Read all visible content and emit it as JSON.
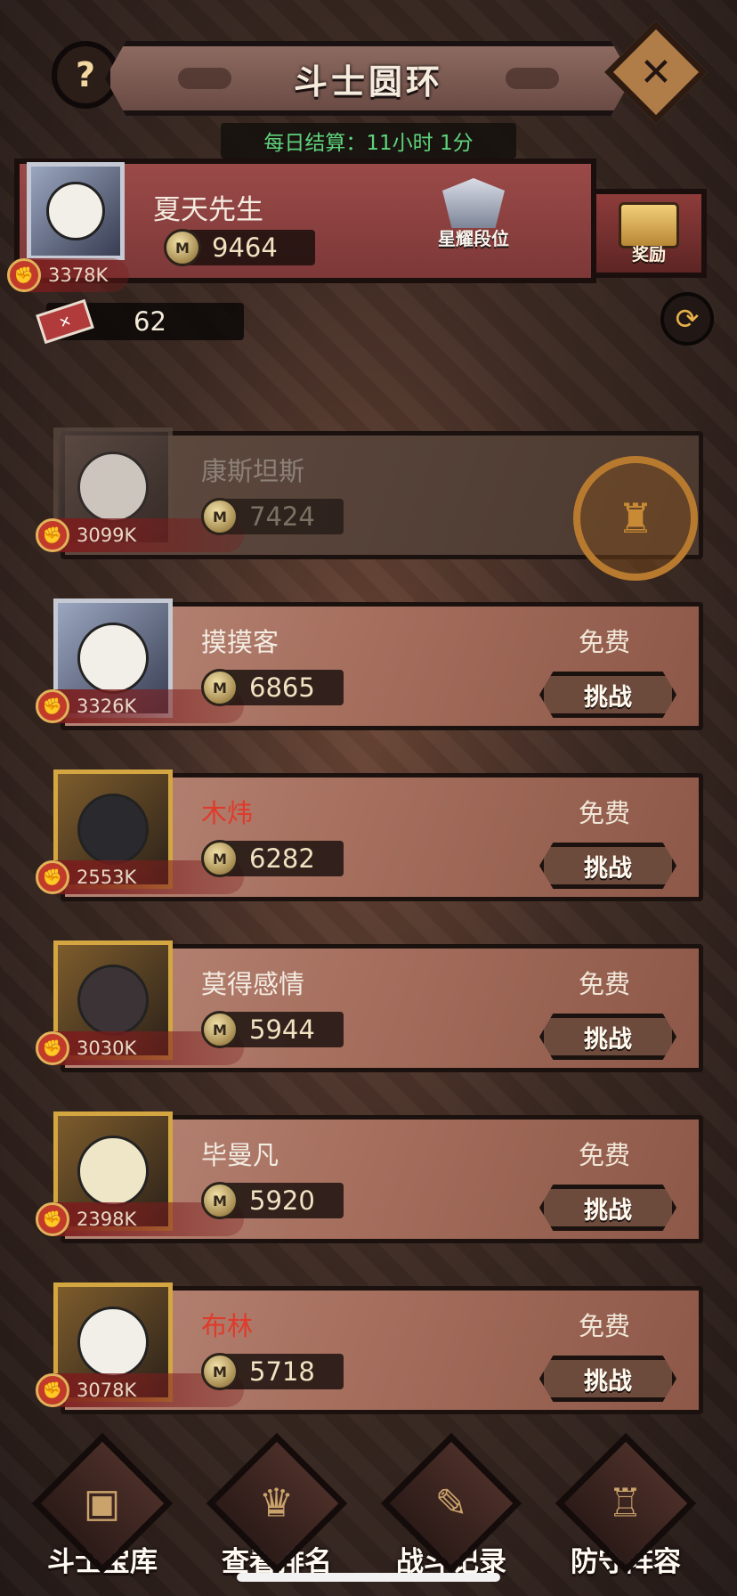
{
  "header": {
    "title": "斗士圆环",
    "help_icon": "?",
    "close_icon": "✕",
    "daily_settlement": "每日结算：11小时 1分"
  },
  "player": {
    "name": "夏天先生",
    "score": "9464",
    "power": "3378K",
    "rank_label": "星耀段位",
    "reward_label": "奖励",
    "tickets": "62"
  },
  "opponents": [
    {
      "name": "康斯坦斯",
      "score": "7424",
      "power": "3099K",
      "defeated": true
    },
    {
      "name": "摸摸客",
      "score": "6865",
      "power": "3326K",
      "free": "免费",
      "action": "挑战"
    },
    {
      "name": "木炜",
      "score": "6282",
      "power": "2553K",
      "free": "免费",
      "action": "挑战"
    },
    {
      "name": "莫得感情",
      "score": "5944",
      "power": "3030K",
      "free": "免费",
      "action": "挑战"
    },
    {
      "name": "毕曼凡",
      "score": "5920",
      "power": "2398K",
      "free": "免费",
      "action": "挑战"
    },
    {
      "name": "布林",
      "score": "5718",
      "power": "3078K",
      "free": "免费",
      "action": "挑战"
    }
  ],
  "bottom_nav": [
    {
      "label": "斗士宝库",
      "icon": "treasure-chest-icon"
    },
    {
      "label": "查看排名",
      "icon": "trophy-icon"
    },
    {
      "label": "战斗记录",
      "icon": "scroll-icon"
    },
    {
      "label": "防守阵容",
      "icon": "tower-icon"
    }
  ],
  "colors": {
    "name_highlight": "#e03a2a",
    "timer_green": "#5ed47b",
    "card_base": "#a66f5e"
  }
}
